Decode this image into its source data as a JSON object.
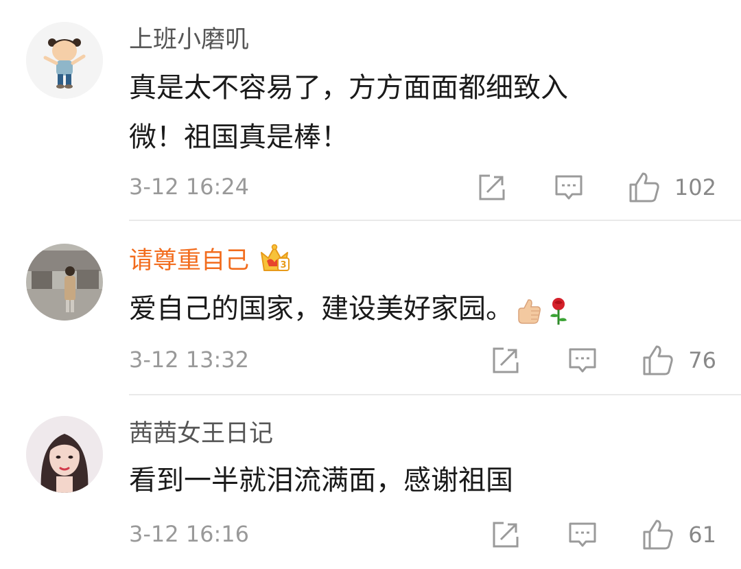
{
  "comments": [
    {
      "username": "上班小磨叽",
      "text_line1": "真是太不容易了，方方面面都细致入",
      "text_line2": "微！祖国真是棒！",
      "timestamp": "3-12 16:24",
      "likes": "102",
      "avatar": "cartoon-girl-avatar",
      "username_color": "#555555"
    },
    {
      "username": "请尊重自己",
      "badge": "vip-crown-icon",
      "text": "爱自己的国家，建设美好家园。",
      "emojis": [
        "thumbs-up-emoji",
        "rose-emoji"
      ],
      "timestamp": "3-12 13:32",
      "likes": "76",
      "avatar": "person-photo-avatar",
      "username_color": "#f26c1d"
    },
    {
      "username": "茜茜女王日记",
      "text": "看到一半就泪流满面，感谢祖国",
      "timestamp": "3-12 16:16",
      "likes": "61",
      "avatar": "woman-portrait-avatar",
      "username_color": "#555555"
    }
  ],
  "icons": {
    "share": "share-icon",
    "comment": "comment-icon",
    "like": "thumbs-up-icon"
  },
  "colors": {
    "vip_orange": "#f26c1d",
    "meta_gray": "#999999",
    "text_dark": "#1a1a1a"
  }
}
